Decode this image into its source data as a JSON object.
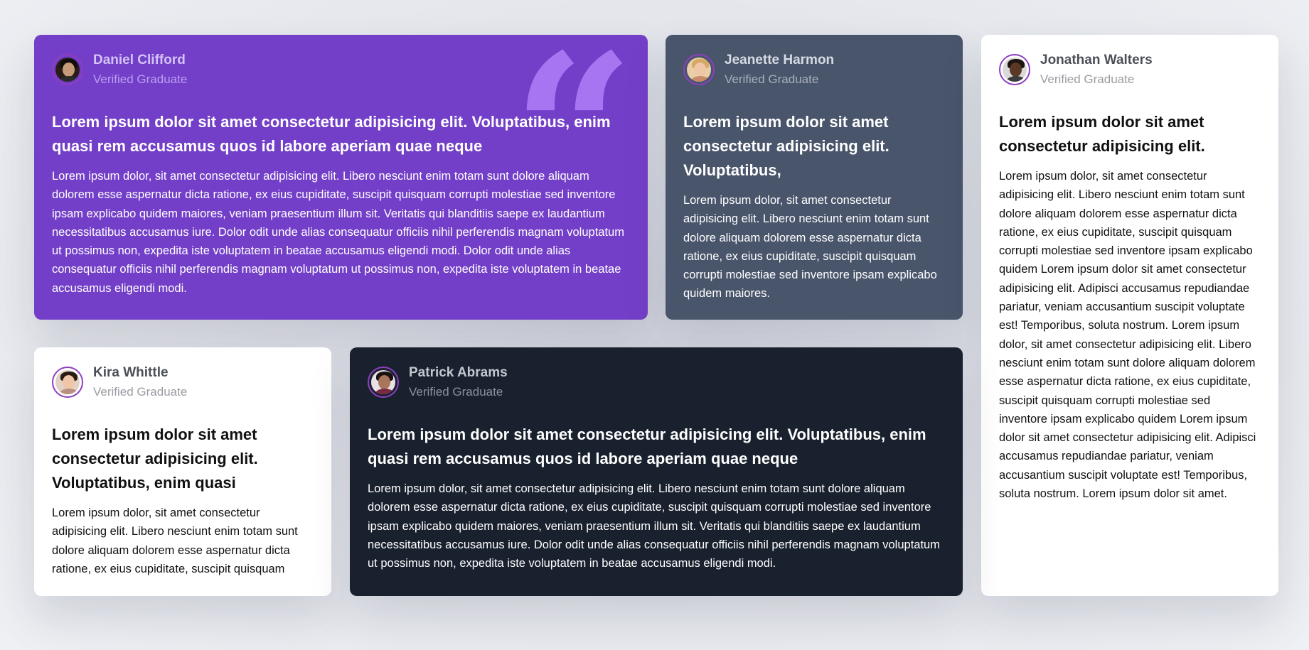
{
  "testimonials": [
    {
      "name": "Daniel Clifford",
      "role": "Verified Graduate",
      "title": "Lorem ipsum dolor sit amet consectetur adipisicing elit. Voluptatibus, enim quasi rem accusamus quos id labore aperiam quae neque",
      "text": "Lorem ipsum dolor, sit amet consectetur adipisicing elit. Libero nesciunt enim totam sunt dolore aliquam dolorem esse aspernatur dicta ratione, ex eius cupiditate, suscipit quisquam corrupti molestiae sed inventore ipsam explicabo quidem maiores, veniam praesentium illum sit. Veritatis qui blanditiis saepe ex laudantium necessitatibus accusamus iure. Dolor odit unde alias consequatur officiis nihil perferendis magnam voluptatum ut possimus non, expedita iste voluptatem in beatae accusamus eligendi modi. Dolor odit unde alias consequatur officiis nihil perferendis magnam voluptatum ut possimus non, expedita iste voluptatem in beatae accusamus eligendi modi.",
      "quote_mark": "“",
      "background": "#733fc8"
    },
    {
      "name": "Jeanette Harmon",
      "role": "Verified Graduate",
      "title": "Lorem ipsum dolor sit amet consectetur adipisicing elit. Voluptatibus,",
      "text": "Lorem ipsum dolor, sit amet consectetur adipisicing elit. Libero nesciunt enim totam sunt dolore aliquam dolorem esse aspernatur dicta ratione, ex eius cupiditate, suscipit quisquam corrupti molestiae sed inventore ipsam explicabo quidem maiores.",
      "background": "#49556b"
    },
    {
      "name": "Jonathan Walters",
      "role": "Verified Graduate",
      "title": "Lorem ipsum dolor sit amet consectetur adipisicing elit.",
      "text": "Lorem ipsum dolor, sit amet consectetur adipisicing elit. Libero nesciunt enim totam sunt dolore aliquam dolorem esse aspernatur dicta ratione, ex eius cupiditate, suscipit quisquam corrupti molestiae sed inventore ipsam explicabo quidem Lorem ipsum dolor sit amet consectetur adipisicing elit. Adipisci accusamus repudiandae pariatur, veniam accusantium suscipit voluptate est! Temporibus, soluta nostrum. Lorem ipsum dolor, sit amet consectetur adipisicing elit. Libero nesciunt enim totam sunt dolore aliquam dolorem esse aspernatur dicta ratione, ex eius cupiditate, suscipit quisquam corrupti molestiae sed inventore ipsam explicabo quidem Lorem ipsum dolor sit amet consectetur adipisicing elit. Adipisci accusamus repudiandae pariatur, veniam accusantium suscipit voluptate est! Temporibus, soluta nostrum. Lorem ipsum dolor sit amet.",
      "background": "#ffffff"
    },
    {
      "name": "Kira Whittle",
      "role": "Verified Graduate",
      "title": "Lorem ipsum dolor sit amet consectetur adipisicing elit. Voluptatibus, enim quasi",
      "text": "Lorem ipsum dolor, sit amet consectetur adipisicing elit. Libero nesciunt enim totam sunt dolore aliquam dolorem esse aspernatur dicta ratione, ex eius cupiditate, suscipit quisquam",
      "background": "#ffffff"
    },
    {
      "name": "Patrick Abrams",
      "role": "Verified Graduate",
      "title": "Lorem ipsum dolor sit amet consectetur adipisicing elit. Voluptatibus, enim quasi rem accusamus quos id labore aperiam quae neque",
      "text": "Lorem ipsum dolor, sit amet consectetur adipisicing elit. Libero nesciunt enim totam sunt dolore aliquam dolorem esse aspernatur dicta ratione, ex eius cupiditate, suscipit quisquam corrupti molestiae sed inventore ipsam explicabo quidem maiores, veniam praesentium illum sit. Veritatis qui blanditiis saepe ex laudantium necessitatibus accusamus iure. Dolor odit unde alias consequatur officiis nihil perferendis magnam voluptatum ut possimus non, expedita iste voluptatem in beatae accusamus eligendi modi.",
      "background": "#19212e"
    }
  ],
  "colors": {
    "avatar_ring": "#8e3fc0",
    "quote_mark": "#a775f1"
  }
}
